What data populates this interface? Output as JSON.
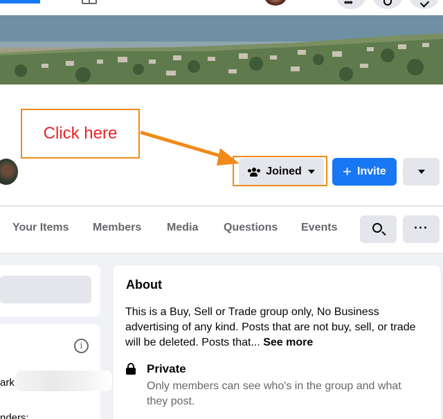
{
  "callout": {
    "text": "Click here",
    "border_color": "#f08a1a",
    "text_color": "#e8232a"
  },
  "group_actions": {
    "joined_label": "Joined",
    "invite_label": "Invite"
  },
  "tabs": [
    {
      "label": "Your Items"
    },
    {
      "label": "Members"
    },
    {
      "label": "Media"
    },
    {
      "label": "Questions"
    },
    {
      "label": "Events"
    }
  ],
  "left_panel": {
    "info_glyph": "i",
    "partial_text_1": "ark",
    "partial_text_2": "nders:"
  },
  "about": {
    "title": "About",
    "description": "This is a Buy, Sell or Trade group only, No Business advertising of any kind. Posts that are not buy, sell, or trade will be deleted. Posts that...",
    "see_more": "See more",
    "privacy_title": "Private",
    "privacy_desc": "Only members can see who's in the group and what they post."
  },
  "colors": {
    "primary_blue": "#1877f2",
    "button_gray": "#e4e6eb",
    "page_bg": "#f0f2f5",
    "annotation_orange": "#f08a1a"
  },
  "icons": [
    "marketplace-icon",
    "menu-icon",
    "messenger-icon",
    "notifications-icon",
    "people-icon",
    "caret-down-icon",
    "plus-icon",
    "chevron-down-icon",
    "search-icon",
    "more-icon",
    "info-icon",
    "lock-icon"
  ]
}
